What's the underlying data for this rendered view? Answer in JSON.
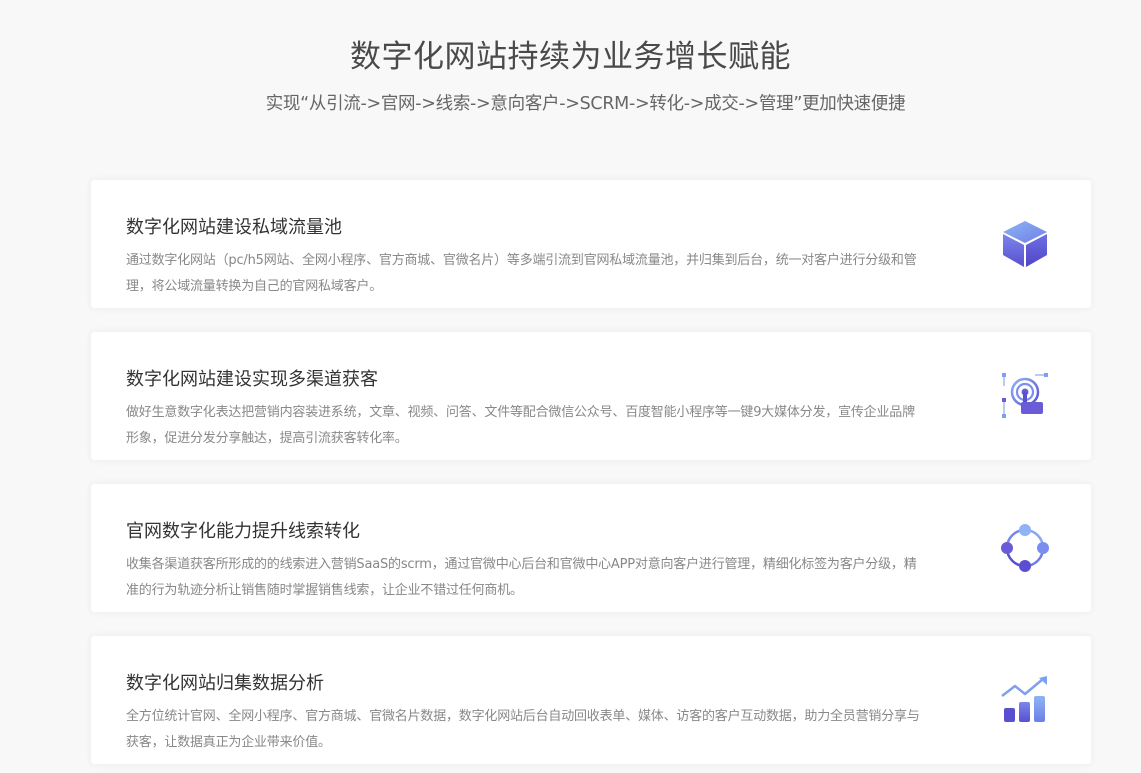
{
  "header": {
    "title": "数字化网站持续为业务增长赋能",
    "subtitle": "实现“从引流->官网->线索->意向客户->SCRM->转化->成交->管理”更加快速便捷"
  },
  "features": [
    {
      "title": "数字化网站建设私域流量池",
      "description": "通过数字化网站（pc/h5网站、全网小程序、官方商城、官微名片）等多端引流到官网私域流量池，并归集到后台，统一对客户进行分级和管理，将公域流量转换为自己的官网私域客户。",
      "icon": "cube-icon"
    },
    {
      "title": "数字化网站建设实现多渠道获客",
      "description": "做好生意数字化表达把营销内容装进系统，文章、视频、问答、文件等配合微信公众号、百度智能小程序等一键9大媒体分发，宣传企业品牌形象，促进分发分享触达，提高引流获客转化率。",
      "icon": "touch-network-icon"
    },
    {
      "title": "官网数字化能力提升线索转化",
      "description": "收集各渠道获客所形成的的线索进入营销SaaS的scrm，通过官微中心后台和官微中心APP对意向客户进行管理，精细化标签为客户分级，精准的行为轨迹分析让销售随时掌握销售线索，让企业不错过任何商机。",
      "icon": "cycle-nodes-icon"
    },
    {
      "title": "数字化网站归集数据分析",
      "description": "全方位统计官网、全网小程序、官方商城、官微名片数据，数字化网站后台自动回收表单、媒体、访客的客户互动数据，助力全员营销分享与获客，让数据真正为企业带来价值。",
      "icon": "bar-chart-growth-icon"
    }
  ],
  "colors": {
    "accent_dark": "#6a5cd6",
    "accent_light": "#7fa0ef"
  }
}
